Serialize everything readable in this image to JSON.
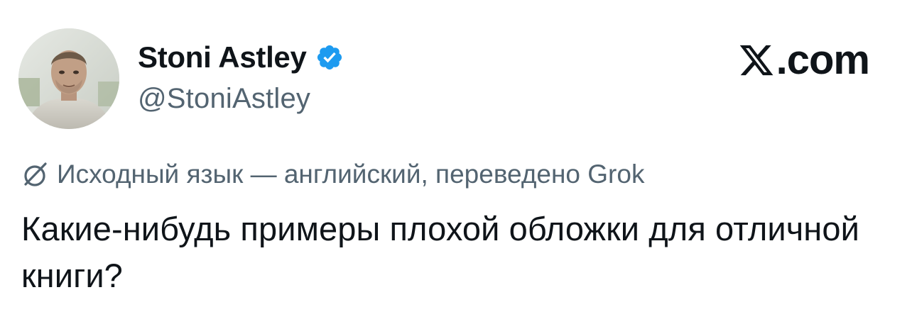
{
  "author": {
    "display_name": "Stoni Astley",
    "handle": "@StoniAstley",
    "verified": true,
    "avatar_icon": "profile-photo"
  },
  "brand": {
    "logo_icon": "x-logo-icon",
    "text": ".com"
  },
  "translation": {
    "icon": "grok-icon",
    "note": "Исходный язык — английский, переведено Grok"
  },
  "tweet": {
    "text": "Какие-нибудь примеры плохой обложки для отличной книги?"
  },
  "colors": {
    "text_primary": "#0f1419",
    "text_secondary": "#536471",
    "verified_blue": "#1d9bf0"
  }
}
